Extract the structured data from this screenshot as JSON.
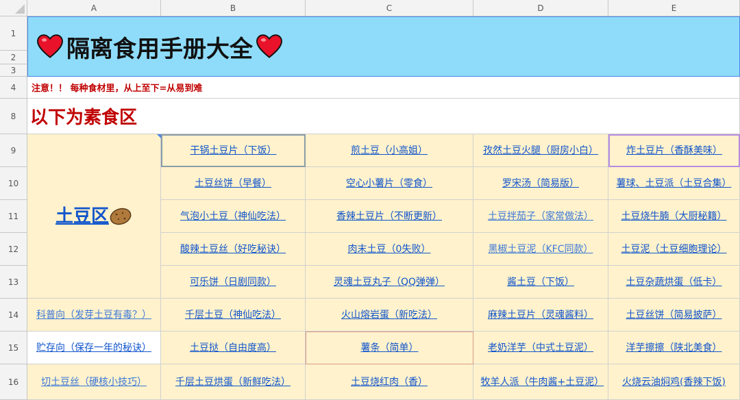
{
  "columns": [
    "A",
    "B",
    "C",
    "D",
    "E"
  ],
  "rows": [
    "1",
    "2",
    "3",
    "4",
    "8",
    "9",
    "10",
    "11",
    "12",
    "13",
    "14",
    "15",
    "16"
  ],
  "title": "隔离食用手册大全",
  "note": "注意！！ 每种食材里，从上至下=从易到难",
  "section": "以下为素食区",
  "potato_label": "土豆区",
  "colA": [
    "科普向（发芽土豆有毒？）",
    "贮存向（保存一年的秘诀）",
    "切土豆丝（硬核小技巧）"
  ],
  "grid": [
    [
      "干锅土豆片（下饭）",
      "煎土豆（小高姐）",
      "孜然土豆火腿（厨房小白）",
      "炸土豆片（香酥美味）"
    ],
    [
      "土豆丝饼（早餐）",
      "空心小薯片（零食）",
      "罗宋汤（简易版）",
      "薯球、土豆派（土豆合集）"
    ],
    [
      "气泡小土豆（神仙吃法）",
      "香辣土豆片（不断更新）",
      "土豆拌茄子（家常做法）",
      "土豆烧牛腩（大厨秘籍）"
    ],
    [
      "酸辣土豆丝（好吃秘诀）",
      "肉末土豆（0失败）",
      "黑椒土豆泥（KFC同款）",
      "土豆泥（土豆细胞理论）"
    ],
    [
      "可乐饼（日剧同款）",
      "灵魂土豆丸子（QQ弹弹）",
      "酱土豆（下饭）",
      "土豆杂蔬烘蛋（低卡）"
    ],
    [
      "千层土豆（神仙吃法）",
      "火山熔岩蛋（新吃法）",
      "麻辣土豆片（灵魂酱料）",
      "土豆丝饼（简易披萨）"
    ],
    [
      "土豆挞（自由度高）",
      "薯条（简单）",
      "老奶洋芋（中式土豆泥）",
      "洋芋擦擦（陕北美食）"
    ],
    [
      "千层土豆烘蛋（新鲜吃法）",
      "土豆烧红肉（香）",
      "牧羊人派（牛肉酱+土豆泥）",
      "火烧云油焖鸡(香辣下饭)"
    ]
  ],
  "colors": {
    "title_bg": "#8fdcfa",
    "cream": "#fff2cc",
    "link": "#1155cc",
    "red": "#c00000"
  },
  "icons": [
    "heart-icon",
    "potato-icon"
  ]
}
